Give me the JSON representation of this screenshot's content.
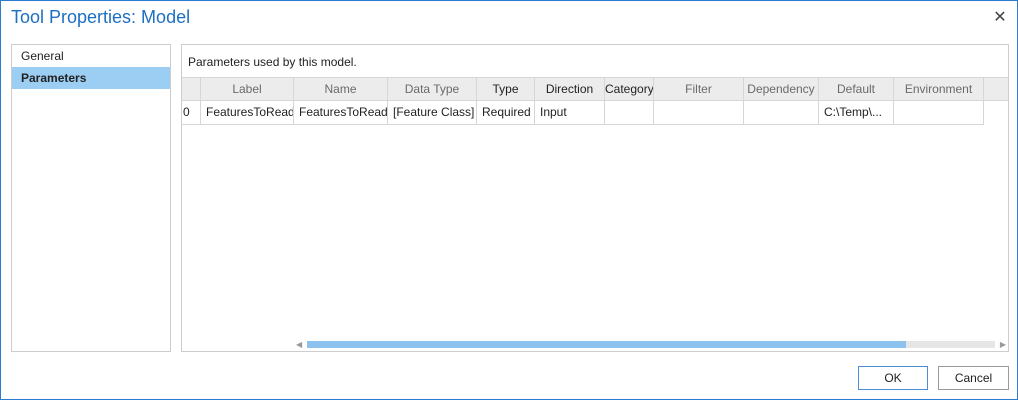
{
  "window": {
    "title": "Tool Properties: Model",
    "close_glyph": "✕"
  },
  "sidebar": {
    "items": [
      {
        "label": "General",
        "active": false
      },
      {
        "label": "Parameters",
        "active": true
      }
    ]
  },
  "parameters": {
    "description": "Parameters used by this model.",
    "columns": [
      "",
      "Label",
      "Name",
      "Data Type",
      "Type",
      "Direction",
      "Category",
      "Filter",
      "Dependency",
      "Default",
      "Environment",
      ""
    ],
    "rows": [
      [
        "0",
        "FeaturesToRead",
        "FeaturesToRead",
        "[Feature Class]",
        "Required",
        "Input",
        "",
        "",
        "",
        "C:\\Temp\\...",
        "",
        ""
      ]
    ],
    "scroll_position": 0.87,
    "scroll_left_glyph": "◀",
    "scroll_right_glyph": "▶"
  },
  "buttons": {
    "ok": "OK",
    "cancel": "Cancel"
  }
}
